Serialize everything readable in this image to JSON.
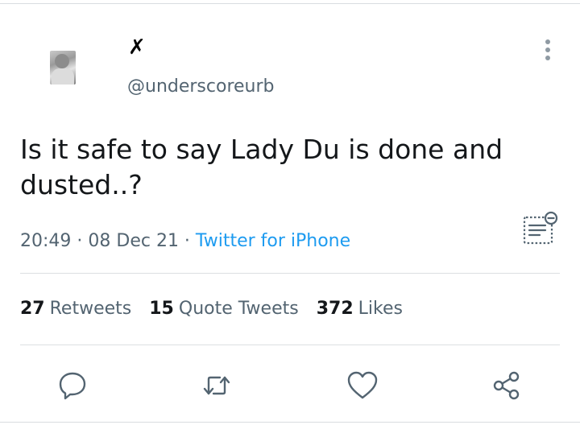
{
  "tweet": {
    "display_name": "✗",
    "handle": "@underscoreurb",
    "text": "Is it safe to say Lady Du is done and dusted..?",
    "time": "20:49",
    "date": "08 Dec 21",
    "source": "Twitter for iPhone",
    "separator": " · "
  },
  "stats": {
    "retweets_count": "27",
    "retweets_label": "Retweets",
    "quotes_count": "15",
    "quotes_label": "Quote Tweets",
    "likes_count": "372",
    "likes_label": "Likes"
  },
  "icons": {
    "more": "more-vertical-icon",
    "transcribe": "translate-icon",
    "reply": "reply-icon",
    "retweet": "retweet-icon",
    "like": "heart-icon",
    "share": "share-icon"
  },
  "colors": {
    "text": "#14171a",
    "secondary": "#536471",
    "link": "#1d9bf0",
    "icon": "#536471"
  }
}
